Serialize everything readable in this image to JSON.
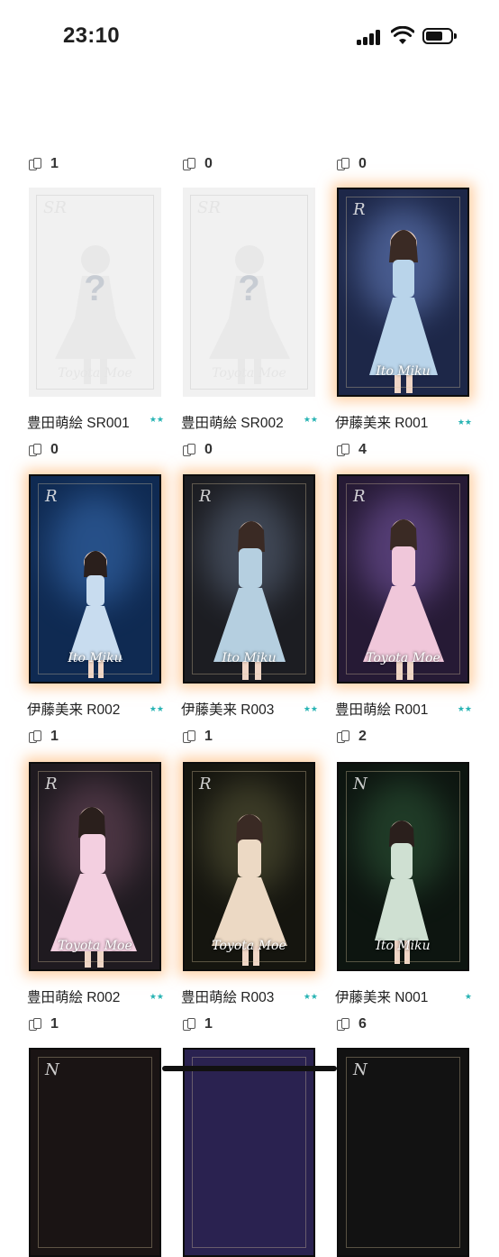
{
  "status_bar": {
    "time": "23:10"
  },
  "rows": [
    {
      "counts": [
        "1",
        "0",
        "0"
      ]
    },
    {
      "cards": [
        {
          "name": "豊田萌絵 SR001",
          "rank": "SR",
          "signature": "Toyota Moe",
          "locked": true,
          "mystery": "?",
          "stars": "★★",
          "theme": "#f1f1f1"
        },
        {
          "name": "豊田萌絵 SR002",
          "rank": "SR",
          "signature": "Toyota Moe",
          "locked": true,
          "mystery": "?",
          "stars": "★★",
          "theme": "#f1f1f1"
        },
        {
          "name": "伊藤美来 R001",
          "rank": "R",
          "signature": "Ito Miku",
          "locked": false,
          "stars": "★★",
          "theme": "#1d2748",
          "dress": "#b9d4ea"
        }
      ],
      "counts": [
        "0",
        "0",
        "4"
      ]
    },
    {
      "cards": [
        {
          "name": "伊藤美来 R002",
          "rank": "R",
          "signature": "Ito Miku",
          "locked": false,
          "stars": "★★",
          "theme": "#0f2a52",
          "dress": "#c8dcef"
        },
        {
          "name": "伊藤美来 R003",
          "rank": "R",
          "signature": "Ito Miku",
          "locked": false,
          "stars": "★★",
          "theme": "#1c1d22",
          "dress": "#b5cfe0"
        },
        {
          "name": "豊田萌絵 R001",
          "rank": "R",
          "signature": "Toyota Moe",
          "locked": false,
          "stars": "★★",
          "theme": "#261a35",
          "dress": "#f0c7da"
        }
      ],
      "counts": [
        "1",
        "1",
        "2"
      ]
    },
    {
      "cards": [
        {
          "name": "豊田萌絵 R002",
          "rank": "R",
          "signature": "Toyota Moe",
          "locked": false,
          "stars": "★★",
          "theme": "#1f1a20",
          "dress": "#f3cfe0"
        },
        {
          "name": "豊田萌絵 R003",
          "rank": "R",
          "signature": "Toyota Moe",
          "locked": false,
          "stars": "★★",
          "theme": "#15150f",
          "dress": "#ecd9c4"
        },
        {
          "name": "伊藤美来 N001",
          "rank": "N",
          "signature": "Ito Miku",
          "locked": false,
          "stars": "★",
          "theme": "#0d1510",
          "dress": "#cfe0d2"
        }
      ],
      "counts": [
        "1",
        "1",
        "6"
      ]
    },
    {
      "cards": [
        {
          "rank": "N",
          "theme": "#1a1414"
        },
        {
          "rank": "N",
          "theme": "#2a2250"
        },
        {
          "rank": "N",
          "theme": "#121212"
        }
      ]
    }
  ]
}
